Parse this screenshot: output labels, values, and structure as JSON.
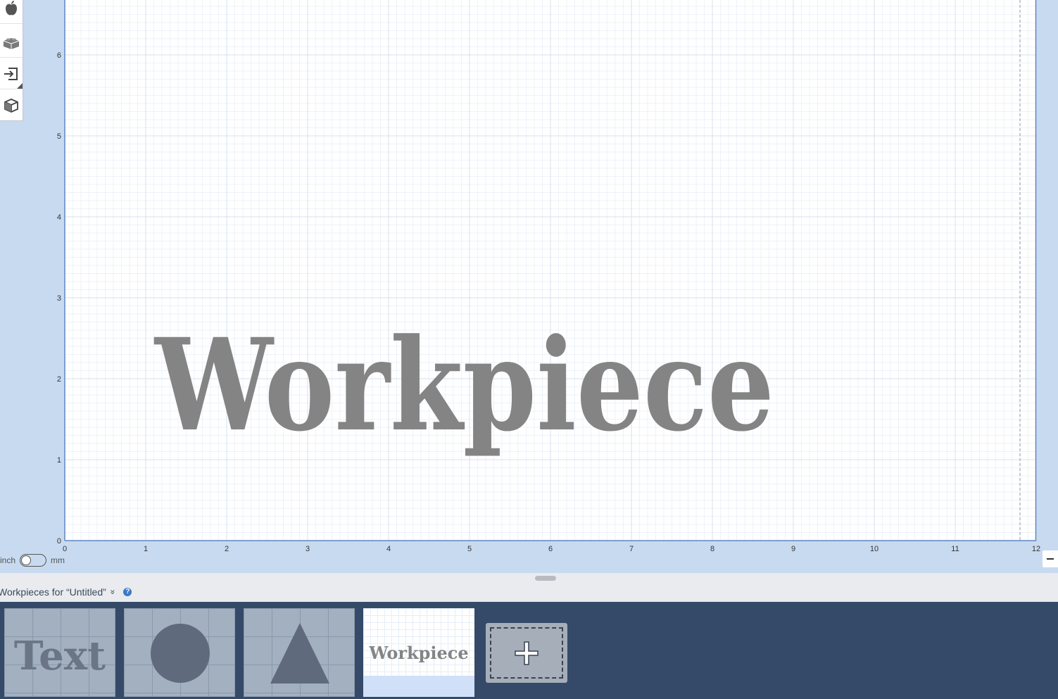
{
  "canvas": {
    "x_ticks": [
      "0",
      "1",
      "2",
      "3",
      "4",
      "5",
      "6",
      "7",
      "8",
      "9",
      "10",
      "11",
      "12"
    ],
    "y_ticks": [
      "0",
      "1",
      "2",
      "3",
      "4",
      "5",
      "6"
    ],
    "workpiece_text": "Workpiece",
    "workpiece_color": "#848484"
  },
  "toolbar": {
    "items": [
      {
        "name": "apple-icon"
      },
      {
        "name": "lego-brick-icon"
      },
      {
        "name": "import-icon"
      },
      {
        "name": "3d-box-icon"
      }
    ]
  },
  "units": {
    "left_label": "inch",
    "right_label": "mm"
  },
  "zoom": {
    "minus_label": "−"
  },
  "panel": {
    "title": "Workpieces for “Untitled”",
    "chevron": "»",
    "help": "?"
  },
  "tray": {
    "thumbnails": [
      {
        "label": "Text",
        "kind": "text"
      },
      {
        "label": "",
        "kind": "circle"
      },
      {
        "label": "",
        "kind": "triangle"
      },
      {
        "label": "Workpiece",
        "kind": "workpiece"
      }
    ],
    "add_label": "+"
  },
  "colors": {
    "tray_bg": "#344a68",
    "canvas_bg": "#c8daf0",
    "shape_fill": "#5f6b7d"
  }
}
